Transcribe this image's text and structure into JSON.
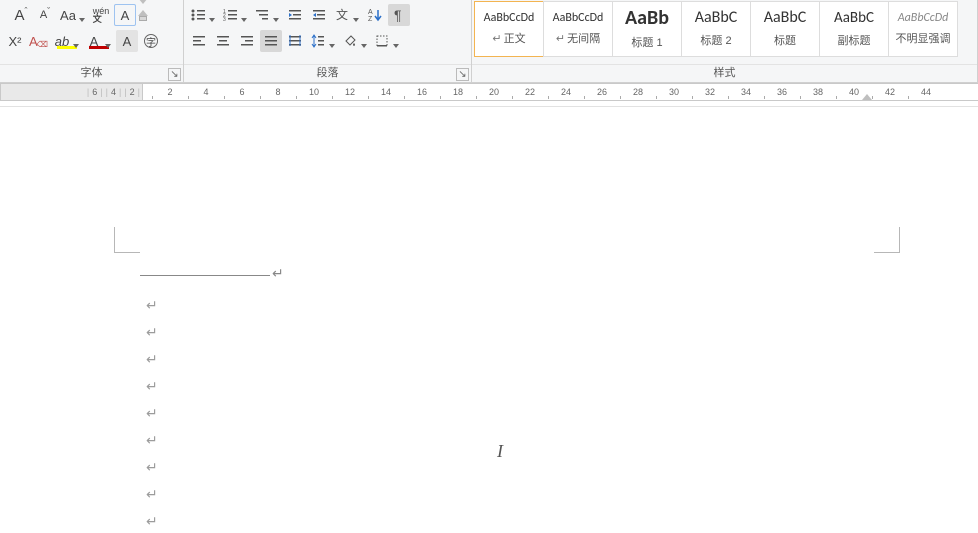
{
  "ribbon": {
    "font_group_label": "字体",
    "para_group_label": "段落",
    "styles_group_label": "样式",
    "font_row1": {
      "grow": "A",
      "shrink": "A",
      "case": "Aa",
      "phonetic": "wén",
      "char_border": "A"
    },
    "font_row2": {
      "superscript": "X²",
      "clear_format": "A",
      "highlight": "ab",
      "font_color": "A",
      "shading": "A",
      "enclose": "字"
    },
    "para_row1": {},
    "styles": [
      {
        "preview": "AaBbCcDd",
        "name": "正文",
        "mark": "↵",
        "size": "12px",
        "weight": "400",
        "selected": true,
        "italic": false
      },
      {
        "preview": "AaBbCcDd",
        "name": "无间隔",
        "mark": "↵",
        "size": "12px",
        "weight": "400",
        "selected": false,
        "italic": false
      },
      {
        "preview": "AaBb",
        "name": "标题 1",
        "mark": "",
        "size": "20px",
        "weight": "700",
        "selected": false,
        "italic": false
      },
      {
        "preview": "AaBbC",
        "name": "标题 2",
        "mark": "",
        "size": "16px",
        "weight": "400",
        "selected": false,
        "italic": false
      },
      {
        "preview": "AaBbC",
        "name": "标题",
        "mark": "",
        "size": "16px",
        "weight": "400",
        "selected": false,
        "italic": false
      },
      {
        "preview": "AaBbC",
        "name": "副标题",
        "mark": "",
        "size": "15px",
        "weight": "400",
        "selected": false,
        "italic": false
      },
      {
        "preview": "AaBbCcDd",
        "name": "不明显强调",
        "mark": "",
        "size": "12px",
        "weight": "400",
        "selected": false,
        "italic": true
      }
    ]
  },
  "ruler": {
    "left_ticks": [
      "6",
      "4",
      "2"
    ],
    "ticks": [
      "",
      "2",
      "",
      "4",
      "",
      "6",
      "",
      "8",
      "",
      "10",
      "",
      "12",
      "",
      "14",
      "",
      "16",
      "",
      "18",
      "",
      "20",
      "",
      "22",
      "",
      "24",
      "",
      "26",
      "",
      "28",
      "",
      "30",
      "",
      "32",
      "",
      "34",
      "",
      "36",
      "",
      "38",
      "",
      "40",
      "",
      "42",
      "",
      "44"
    ]
  },
  "document": {
    "para_marks_count": 9,
    "cursor_end_glyph": "↵",
    "ibeam_glyph": "I"
  },
  "colors": {
    "highlight": "#ffff00",
    "font_color": "#c00000"
  }
}
